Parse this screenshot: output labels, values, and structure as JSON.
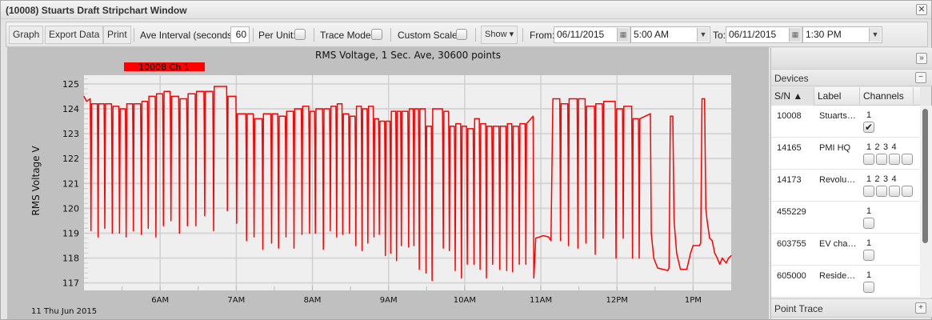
{
  "window": {
    "title": "(10008) Stuarts Draft Stripchart Window",
    "close_icon": "close-icon"
  },
  "toolbar": {
    "graph": "Graph",
    "export": "Export Data",
    "print": "Print",
    "ave_interval_label": "Ave Interval (seconds)",
    "ave_interval_value": "60",
    "per_unit_label": "Per Unit:",
    "per_unit_checked": false,
    "trace_mode_label": "Trace Mode:",
    "trace_mode_checked": false,
    "custom_scale_label": "Custom Scale:",
    "custom_scale_checked": false,
    "show": "Show ▾",
    "from_label": "From:",
    "from_date": "06/11/2015",
    "from_time": "5:00 AM",
    "to_label": "To:",
    "to_date": "06/11/2015",
    "to_time": "1:30 PM"
  },
  "chart_data": {
    "type": "line",
    "title": "RMS Voltage, 1 Sec. Ave, 30600 points",
    "ylabel": "RMS Voltage V",
    "date_label": "11 Thu Jun 2015",
    "ylim": [
      116.7,
      125.35
    ],
    "xlim": [
      "05:00:00",
      "13:30:00"
    ],
    "yticks": [
      "117",
      "118",
      "119",
      "120",
      "121",
      "122",
      "123",
      "124",
      "125"
    ],
    "xticks": [
      {
        "t": "06:00:00",
        "label": "6AM"
      },
      {
        "t": "07:00:00",
        "label": "7AM"
      },
      {
        "t": "08:00:00",
        "label": "8AM"
      },
      {
        "t": "09:00:00",
        "label": "9AM"
      },
      {
        "t": "10:00:00",
        "label": "10AM"
      },
      {
        "t": "11:00:00",
        "label": "11AM"
      },
      {
        "t": "12:00:00",
        "label": "12PM"
      },
      {
        "t": "13:00:00",
        "label": "1PM"
      }
    ],
    "grid": true,
    "legend": {
      "label": "10008 Ch 1",
      "position": "top-left"
    },
    "series_color": "#ff0000",
    "series": [
      {
        "name": "10008 Ch 1",
        "dips": [
          [
            "05:05:30",
            124.4,
            119.1
          ],
          [
            "05:11:06",
            124.2,
            118.85
          ],
          [
            "05:16:24",
            124.2,
            119.2
          ],
          [
            "05:22:18",
            124.2,
            119.0
          ],
          [
            "05:28:00",
            124.1,
            119.0
          ],
          [
            "05:33:12",
            124.0,
            118.85
          ],
          [
            "05:38:54",
            124.2,
            119.1
          ],
          [
            "05:45:12",
            124.2,
            118.95
          ],
          [
            "05:50:36",
            124.3,
            119.2
          ],
          [
            "05:56:42",
            124.5,
            118.85
          ],
          [
            "06:02:36",
            124.6,
            119.3
          ],
          [
            "06:08:30",
            124.7,
            119.5
          ],
          [
            "06:15:12",
            124.5,
            119.0
          ],
          [
            "06:21:30",
            124.4,
            119.3
          ],
          [
            "06:28:12",
            124.6,
            119.3
          ],
          [
            "06:35:06",
            124.7,
            119.7
          ],
          [
            "06:42:06",
            124.7,
            119.1
          ],
          [
            "06:53:00",
            124.9,
            119.9
          ],
          [
            "07:00:18",
            124.5,
            119.4
          ],
          [
            "07:08:06",
            123.8,
            118.7
          ],
          [
            "07:14:00",
            123.8,
            118.85
          ],
          [
            "07:20:54",
            123.6,
            118.35
          ],
          [
            "07:27:48",
            123.8,
            118.6
          ],
          [
            "07:33:18",
            123.8,
            118.4
          ],
          [
            "07:39:12",
            123.7,
            118.85
          ],
          [
            "07:45:30",
            123.9,
            118.4
          ],
          [
            "07:51:48",
            124.0,
            118.95
          ],
          [
            "07:57:42",
            124.1,
            119.0
          ],
          [
            "08:02:18",
            123.9,
            119.0
          ],
          [
            "08:08:36",
            124.0,
            118.35
          ],
          [
            "08:14:06",
            124.0,
            119.1
          ],
          [
            "08:19:06",
            124.1,
            118.85
          ],
          [
            "08:23:54",
            124.2,
            118.95
          ],
          [
            "08:29:12",
            123.8,
            119.0
          ],
          [
            "08:34:12",
            123.7,
            118.5
          ],
          [
            "08:39:06",
            124.1,
            118.3
          ],
          [
            "08:43:42",
            124.0,
            118.6
          ],
          [
            "08:48:30",
            124.1,
            118.85
          ],
          [
            "08:52:42",
            123.6,
            118.95
          ],
          [
            "08:57:30",
            123.5,
            118.1
          ],
          [
            "09:01:42",
            123.5,
            118.2
          ],
          [
            "09:06:18",
            123.9,
            117.9
          ],
          [
            "09:10:06",
            123.9,
            118.5
          ],
          [
            "09:15:48",
            123.9,
            118.45
          ],
          [
            "09:20:00",
            124.0,
            118.5
          ],
          [
            "09:24:12",
            124.0,
            117.55
          ],
          [
            "09:29:30",
            124.0,
            117.4
          ],
          [
            "09:34:18",
            123.3,
            117.1
          ],
          [
            "09:43:06",
            124.0,
            118.4
          ],
          [
            "09:47:54",
            123.9,
            118.3
          ],
          [
            "09:52:30",
            123.3,
            117.5
          ],
          [
            "09:57:24",
            123.4,
            117.2
          ],
          [
            "10:02:00",
            123.3,
            117.75
          ],
          [
            "10:07:18",
            123.2,
            117.75
          ],
          [
            "10:12:06",
            123.6,
            117.55
          ],
          [
            "10:17:06",
            123.4,
            117.2
          ],
          [
            "10:22:00",
            123.3,
            117.75
          ],
          [
            "10:27:36",
            123.3,
            117.55
          ],
          [
            "10:33:06",
            123.3,
            117.5
          ],
          [
            "10:37:42",
            123.4,
            117.45
          ],
          [
            "10:43:00",
            123.3,
            117.75
          ],
          [
            "10:48:12",
            123.4,
            117.75
          ],
          [
            "11:15:30",
            124.4,
            118.7
          ],
          [
            "11:21:48",
            124.2,
            118.5
          ],
          [
            "11:29:12",
            124.4,
            118.4
          ],
          [
            "11:35:30",
            124.4,
            118.6
          ],
          [
            "11:42:48",
            124.1,
            118.15
          ],
          [
            "11:49:06",
            124.2,
            118.8
          ],
          [
            "11:59:12",
            124.3,
            118.0
          ],
          [
            "12:04:54",
            124.0,
            118.8
          ],
          [
            "12:12:12",
            124.1,
            118.0
          ],
          [
            "12:17:30",
            123.6,
            118.0
          ]
        ],
        "points": [
          [
            "05:00:00",
            124.5
          ],
          [
            "05:02:00",
            124.3
          ],
          [
            "10:53:54",
            123.7
          ],
          [
            "10:54:30",
            117.2
          ],
          [
            "10:56:00",
            118.8
          ],
          [
            "11:02:00",
            118.9
          ],
          [
            "11:06:00",
            118.85
          ],
          [
            "11:08:00",
            118.7
          ],
          [
            "11:09:30",
            124.4
          ],
          [
            "12:26:18",
            123.8
          ],
          [
            "12:27:00",
            119.0
          ],
          [
            "12:29:00",
            118.0
          ],
          [
            "12:32:00",
            117.6
          ],
          [
            "12:40:00",
            117.5
          ],
          [
            "12:41:00",
            117.6
          ],
          [
            "12:42:00",
            123.7
          ],
          [
            "12:44:00",
            123.7
          ],
          [
            "12:45:00",
            119.5
          ],
          [
            "12:47:00",
            118.2
          ],
          [
            "12:50:00",
            117.55
          ],
          [
            "12:55:00",
            117.55
          ],
          [
            "12:58:00",
            118.2
          ],
          [
            "13:00:00",
            118.5
          ],
          [
            "13:05:00",
            118.5
          ],
          [
            "13:06:00",
            118.6
          ],
          [
            "13:07:00",
            124.4
          ],
          [
            "13:09:00",
            124.4
          ],
          [
            "13:10:00",
            120.0
          ],
          [
            "13:11:00",
            119.5
          ],
          [
            "13:13:00",
            118.8
          ],
          [
            "13:15:00",
            118.7
          ],
          [
            "13:17:00",
            118.2
          ],
          [
            "13:19:00",
            118.0
          ],
          [
            "13:21:00",
            117.75
          ],
          [
            "13:23:00",
            118.0
          ],
          [
            "13:26:00",
            117.8
          ],
          [
            "13:28:00",
            118.0
          ],
          [
            "13:30:00",
            118.1
          ]
        ]
      }
    ]
  },
  "panel": {
    "collapse_icon": "double-chevron-right-icon",
    "devices_title": "Devices",
    "columns": {
      "sn": "S/N ▲",
      "label": "Label",
      "channels": "Channels"
    },
    "devices": [
      {
        "sn": "10008",
        "label": "Stuarts…",
        "channels": [
          "1"
        ],
        "checked": [
          true
        ]
      },
      {
        "sn": "14165",
        "label": "PMI HQ",
        "channels": [
          "1",
          "2",
          "3",
          "4"
        ],
        "checked": [
          false,
          false,
          false,
          false
        ]
      },
      {
        "sn": "14173",
        "label": "Revolu…",
        "channels": [
          "1",
          "2",
          "3",
          "4"
        ],
        "checked": [
          false,
          false,
          false,
          false
        ]
      },
      {
        "sn": "455229",
        "label": "",
        "channels": [
          "1"
        ],
        "checked": [
          false
        ]
      },
      {
        "sn": "603755",
        "label": "EV cha…",
        "channels": [
          "1"
        ],
        "checked": [
          false
        ]
      },
      {
        "sn": "605000",
        "label": "Reside…",
        "channels": [
          "1"
        ],
        "checked": [
          false
        ]
      }
    ],
    "point_trace_title": "Point Trace"
  }
}
